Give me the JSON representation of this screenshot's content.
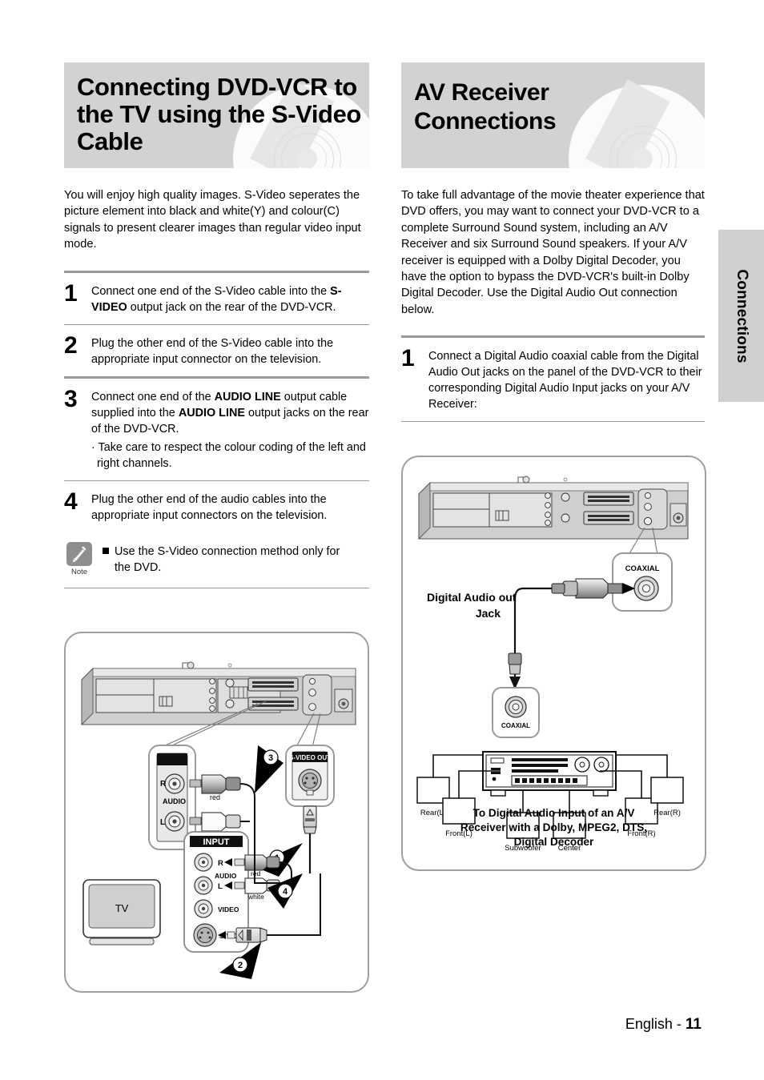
{
  "page": {
    "footer_text": "English - ",
    "footer_page": "11",
    "side_tab": "Connections",
    "colors": {
      "band": "#d2d2d2",
      "rule": "#9a9a9a",
      "frame": "#9f9f9f"
    }
  },
  "left": {
    "title": "Connecting DVD-VCR to the TV using the S-Video Cable",
    "intro": "You will enjoy high quality images. S-Video seperates the picture element into black and white(Y) and colour(C) signals to present clearer images than regular video input mode.",
    "steps": [
      {
        "num": "1",
        "parts": [
          {
            "t": "Connect one end of the S-Video cable into the ",
            "b": false
          },
          {
            "t": "S-VIDEO",
            "b": true
          },
          {
            "t": " output jack on the rear of the DVD-VCR.",
            "b": false
          }
        ]
      },
      {
        "num": "2",
        "parts": [
          {
            "t": "Plug the other end of the S-Video cable into the appropriate input connector on the television.",
            "b": false
          }
        ]
      },
      {
        "num": "3",
        "parts": [
          {
            "t": "Connect one end of the ",
            "b": false
          },
          {
            "t": "AUDIO LINE",
            "b": true
          },
          {
            "t": " output cable supplied into the ",
            "b": false
          },
          {
            "t": "AUDIO LINE",
            "b": true
          },
          {
            "t": " output jacks on the rear of the DVD-VCR.",
            "b": false
          }
        ],
        "sub": "· Take care to respect the colour coding of the left and right channels."
      },
      {
        "num": "4",
        "parts": [
          {
            "t": "Plug the other end of the audio cables into the appropriate input connectors on the television.",
            "b": false
          }
        ]
      }
    ],
    "note": {
      "caption": "Note",
      "line1": "Use the S-Video connection method only for",
      "line2": "the DVD."
    },
    "diagram": {
      "s_video_out_label": "S-VIDEO OUT",
      "audio_label": "AUDIO",
      "audio_r": "R",
      "audio_l": "L",
      "red": "red",
      "white": "white",
      "input_label": "INPUT",
      "tv_label": "TV",
      "tv_r": "R",
      "tv_l": "L",
      "tv_audio": "AUDIO",
      "tv_video": "VIDEO",
      "tv_svideo": "S-VIDEO",
      "callouts": [
        "1",
        "2",
        "3",
        "4"
      ]
    }
  },
  "right": {
    "title": "AV Receiver Connections",
    "intro": "To take full advantage of the movie theater experience that DVD offers, you may want to connect your DVD-VCR to a complete Surround Sound system, including an A/V Receiver and six Surround Sound speakers. If your A/V receiver is equipped with a Dolby Digital Decoder, you have the option to bypass the DVD-VCR's built-in Dolby Digital Decoder. Use the Digital Audio Out connection below.",
    "steps": [
      {
        "num": "1",
        "parts": [
          {
            "t": "Connect a Digital Audio coaxial cable from the Digital Audio Out jacks on the panel of the DVD-VCR to their corresponding Digital Audio Input jacks on your A/V Receiver:",
            "b": false
          }
        ]
      }
    ],
    "diagram": {
      "coaxial_top": "COAXIAL",
      "coaxial_bottom": "COAXIAL",
      "jack_label_line1": "Digital Audio out",
      "jack_label_line2": "Jack",
      "speakers": [
        "Rear(L)",
        "Front(L)",
        "Subwoofer",
        "Center",
        "Front(R)",
        "Rear(R)"
      ],
      "caption_line1": "To Digital Audio Input of an A/V",
      "caption_line2": "Receiver with a Dolby, MPEG2, DTS,",
      "caption_line3": "Digital Decoder"
    }
  }
}
